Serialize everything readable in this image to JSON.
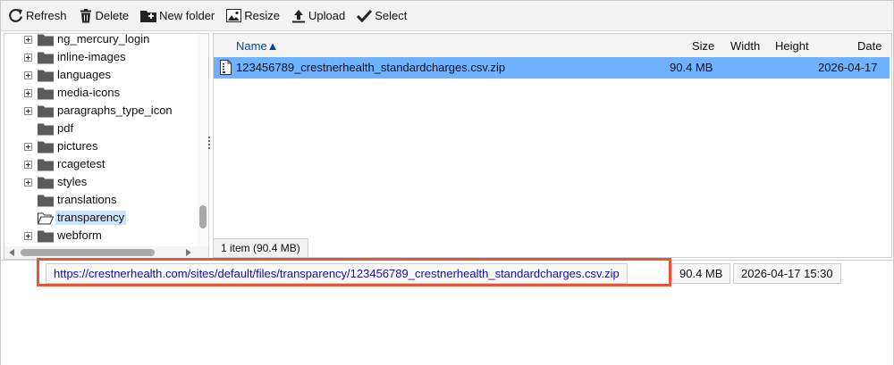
{
  "toolbar": {
    "refresh": "Refresh",
    "delete": "Delete",
    "new_folder": "New folder",
    "resize": "Resize",
    "upload": "Upload",
    "select": "Select"
  },
  "tree": {
    "items": [
      {
        "label": "ng_mercury_login",
        "expandable": true,
        "selected": false
      },
      {
        "label": "inline-images",
        "expandable": true,
        "selected": false
      },
      {
        "label": "languages",
        "expandable": true,
        "selected": false
      },
      {
        "label": "media-icons",
        "expandable": true,
        "selected": false
      },
      {
        "label": "paragraphs_type_icon",
        "expandable": true,
        "selected": false
      },
      {
        "label": "pdf",
        "expandable": false,
        "selected": false
      },
      {
        "label": "pictures",
        "expandable": true,
        "selected": false
      },
      {
        "label": "rcagetest",
        "expandable": true,
        "selected": false
      },
      {
        "label": "styles",
        "expandable": true,
        "selected": false
      },
      {
        "label": "translations",
        "expandable": false,
        "selected": false
      },
      {
        "label": "transparency",
        "expandable": false,
        "selected": true
      },
      {
        "label": "webform",
        "expandable": true,
        "selected": false
      }
    ]
  },
  "list": {
    "headers": {
      "name": "Name▲",
      "size": "Size",
      "width": "Width",
      "height": "Height",
      "date": "Date"
    },
    "rows": [
      {
        "name": "123456789_crestnerhealth_standardcharges.csv.zip",
        "size": "90.4 MB",
        "width": "",
        "height": "",
        "date": "2026-04-17"
      }
    ],
    "status": "1 item (90.4 MB)"
  },
  "details": {
    "url": "https://crestnerhealth.com/sites/default/files/transparency/123456789_crestnerhealth_standardcharges.csv.zip",
    "size": "90.4 MB",
    "datetime": "2026-04-17 15:30"
  },
  "colors": {
    "selected_row": "#6fb2ff",
    "highlight_border": "#e8553a",
    "link": "#1a0dab",
    "folder": "#5a5a5a"
  }
}
